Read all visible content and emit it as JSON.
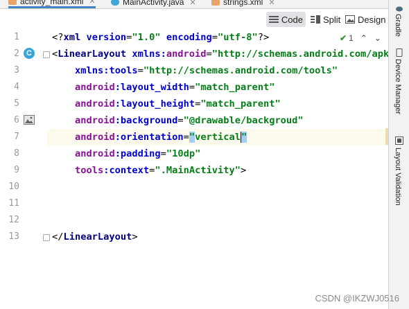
{
  "tabs": [
    {
      "label": "activity_main.xml",
      "icon": "xml-file-icon",
      "active": true
    },
    {
      "label": "MainActivity.java",
      "icon": "java-class-icon",
      "active": false
    },
    {
      "label": "strings.xml",
      "icon": "xml-file-icon",
      "active": false
    }
  ],
  "modes": {
    "code": "Code",
    "split": "Split",
    "design": "Design"
  },
  "inspection": {
    "count": "1"
  },
  "gutter": {
    "line_numbers": [
      "1",
      "2",
      "3",
      "4",
      "5",
      "6",
      "7",
      "8",
      "9",
      "10",
      "11",
      "12",
      "13"
    ],
    "class_badge": "C"
  },
  "code": {
    "l1": {
      "a": "<?",
      "b": "xml",
      "c": " version",
      "d": "=",
      "e": "\"1.0\"",
      "f": " encoding",
      "g": "=",
      "h": "\"utf-8\"",
      "i": "?>"
    },
    "l2": {
      "a": "<",
      "b": "LinearLayout",
      "c": " xmlns:",
      "d": "android",
      "e": "=",
      "f": "\"http://schemas.android.com/apk/res/android\""
    },
    "l3": {
      "a": "xmlns:",
      "b": "tools",
      "c": "=",
      "d": "\"http://schemas.android.com/tools\""
    },
    "l4": {
      "a": "android",
      "b": ":layout_width",
      "c": "=",
      "d": "\"match_parent\""
    },
    "l5": {
      "a": "android",
      "b": ":layout_height",
      "c": "=",
      "d": "\"match_parent\""
    },
    "l6": {
      "a": "android",
      "b": ":background",
      "c": "=",
      "d": "\"@drawable/backgroud\""
    },
    "l7": {
      "a": "android",
      "b": ":orientation",
      "c": "=",
      "q1": "\"",
      "d": "vertical",
      "q2": "\""
    },
    "l8": {
      "a": "android",
      "b": ":padding",
      "c": "=",
      "d": "\"10dp\""
    },
    "l9": {
      "a": "tools",
      "b": ":context",
      "c": "=",
      "d": "\".MainActivity\"",
      "e": ">"
    },
    "l13": {
      "a": "</",
      "b": "LinearLayout",
      "c": ">"
    }
  },
  "side_panels": {
    "gradle": "Gradle",
    "device_manager": "Device Manager",
    "layout_validation": "Layout Validation"
  },
  "watermark": "CSDN @IKZWJ0516",
  "colors": {
    "tag": "#000080",
    "attribute_namespace": "#871094",
    "attribute": "#0000cc",
    "value": "#067d17",
    "current_line": "#fcfaed"
  }
}
